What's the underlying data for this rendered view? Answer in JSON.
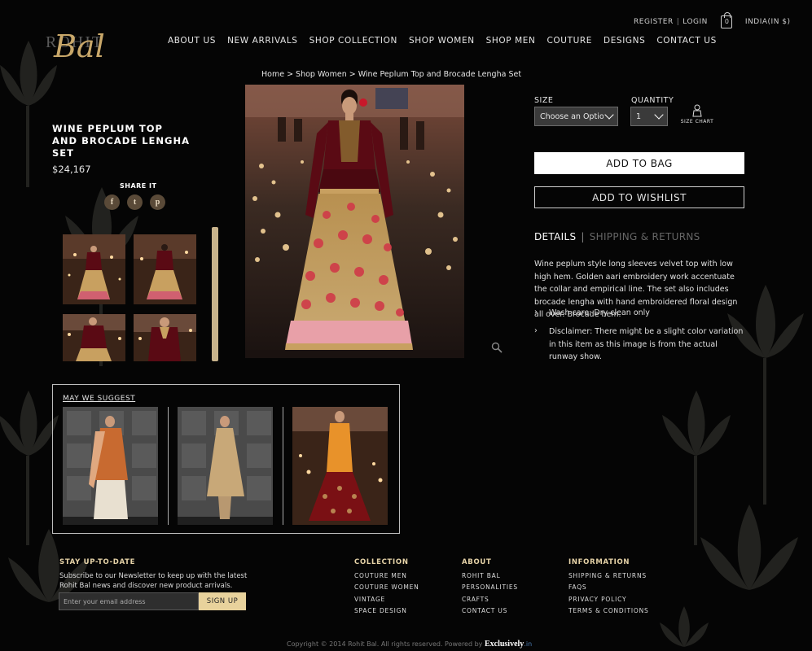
{
  "brand": {
    "logo_script": "Bal",
    "logo_text": "ROHIT",
    "logo_color": "#c9a86a"
  },
  "utility": {
    "register": "REGISTER",
    "sep": "|",
    "login": "LOGIN",
    "bag_count": "0",
    "country": "INDIA(IN $)"
  },
  "nav": [
    "ABOUT US",
    "NEW ARRIVALS",
    "SHOP COLLECTION",
    "SHOP WOMEN",
    "SHOP MEN",
    "COUTURE",
    "DESIGNS",
    "CONTACT US"
  ],
  "breadcrumb": "Home > Shop Women > Wine Peplum Top and Brocade Lengha Set",
  "product": {
    "title": "WINE PEPLUM TOP AND BROCADE LENGHA SET",
    "price": "$24,167",
    "share_label": "SHARE IT",
    "share_icons": [
      {
        "name": "facebook-icon",
        "glyph": "f"
      },
      {
        "name": "twitter-icon",
        "glyph": "t"
      },
      {
        "name": "pinterest-icon",
        "glyph": "p"
      }
    ]
  },
  "options": {
    "size_label": "SIZE",
    "size_value": "Choose an Option...",
    "qty_label": "QUANTITY",
    "qty_value": "1",
    "size_chart": "SIZE CHART"
  },
  "actions": {
    "add_to_bag": "ADD TO BAG",
    "add_to_wishlist": "ADD TO WISHLIST"
  },
  "tabs": {
    "details": "DETAILS",
    "divider": "|",
    "shipping": "SHIPPING & RETURNS"
  },
  "description": "Wine peplum style long sleeves velvet top with low high hem. Golden aari embroidery work accentuate the collar and empirical line. The set also includes brocade lengha with hand embroidered floral design all over. Brocade hem.",
  "bullets": [
    "Wash care: Dry clean only",
    "Disclaimer: There might be a slight color variation in this item as this image is from the actual runway show."
  ],
  "suggest": {
    "title": "MAY WE SUGGEST"
  },
  "footer": {
    "stay_title": "STAY UP-TO-DATE",
    "stay_text": "Subscribe to our Newsletter to keep up with the latest Rohit Bal news and discover new product arrivals.",
    "email_placeholder": "Enter your email address",
    "signup": "SIGN UP",
    "collection_title": "COLLECTION",
    "collection": [
      "COUTURE MEN",
      "COUTURE WOMEN",
      "VINTAGE",
      "SPACE DESIGN"
    ],
    "about_title": "ABOUT",
    "about": [
      "ROHIT BAL",
      "PERSONALITIES",
      "CRAFTS",
      "CONTACT US"
    ],
    "info_title": "INFORMATION",
    "info": [
      "SHIPPING & RETURNS",
      "FAQS",
      "PRIVACY POLICY",
      "TERMS & CONDITIONS"
    ],
    "copyright": "Copyright © 2014 Rohit Bal. All rights reserved. Powered by",
    "powered_brand": "Exclusively",
    "powered_suffix": ".in"
  },
  "colors": {
    "accent_gold": "#e8d29c",
    "background": "#050505",
    "wine": "#6b0f1a"
  }
}
